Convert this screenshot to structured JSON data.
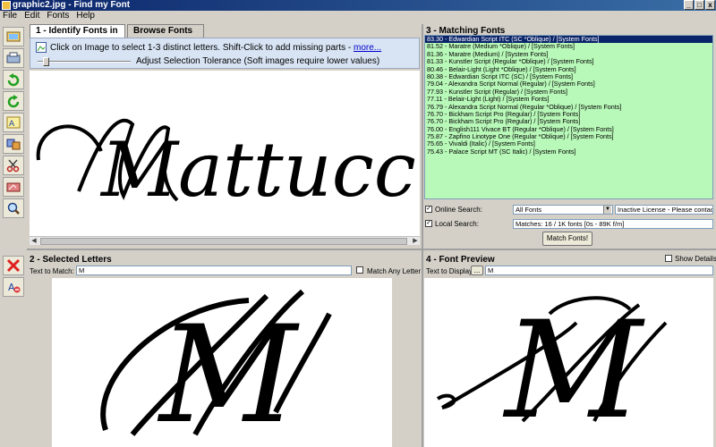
{
  "window": {
    "title": "graphic2.jpg - Find my Font"
  },
  "menu": [
    "File",
    "Edit",
    "Fonts",
    "Help"
  ],
  "panel1": {
    "tabs": [
      "1 - Identify Fonts in Image",
      "Browse Fonts"
    ],
    "info_text": "Click on Image to select 1-3 distinct letters. Shift-Click to add missing parts - ",
    "info_link": "more...",
    "slider_label": "Adjust Selection Tolerance (Soft images require lower values)",
    "slider_value": 0.06,
    "image_text": "Mattucci"
  },
  "panel2": {
    "title": "2 - Selected Letters",
    "text_label": "Text to Match:",
    "text_value": "M",
    "match_any_label": "Match Any Letter",
    "match_any_checked": false,
    "image_text": "M"
  },
  "panel3": {
    "title": "3 - Matching Fonts",
    "results": [
      "83.30 - Edwardian Script ITC (SC *Oblique) / [System Fonts]",
      "81.52 - Maratre (Medium *Oblique) / [System Fonts]",
      "81.36 - Maratre (Medium) / [System Fonts]",
      "81.33 - Kunstler Script (Regular *Oblique) / [System Fonts]",
      "80.46 - Belair-Light (Light *Oblique) / [System Fonts]",
      "80.38 - Edwardian Script ITC (SC) / [System Fonts]",
      "79.04 - Alexandra Script Normal (Regular) / [System Fonts]",
      "77.93 - Kunstler Script (Regular) / [System Fonts]",
      "77.11 - Belair-Light (Light) / [System Fonts]",
      "76.79 - Alexandra Script Normal (Regular *Oblique) / [System Fonts]",
      "76.70 - Bickham Script Pro (Regular) / [System Fonts]",
      "76.70 - Bickham Script Pro (Regular) / [System Fonts]",
      "76.00 - English111 Vivace BT (Regular *Oblique) / [System Fonts]",
      "75.87 - Zapfino Linotype One (Regular *Oblique) / [System Fonts]",
      "75.65 - Vivaldi (Italic) / [System Fonts]",
      "75.43 - Palace Script MT (SC Italic) / [System Fonts]"
    ],
    "online_search_label": "Online Search:",
    "online_search_checked": true,
    "online_select": "All Fonts",
    "license_text": "Inactive License - Please contact sup",
    "local_search_label": "Local Search:",
    "local_search_checked": true,
    "matches_text": "Matches: 16 / 1K fonts [0s - 89K f/m]",
    "match_button": "Match Fonts!"
  },
  "panel4": {
    "title": "4 - Font Preview",
    "show_details_label": "Show Details",
    "show_details_checked": false,
    "text_label": "Text to Display:",
    "ellipsis_button": "...",
    "text_value": "M",
    "image_text": "M"
  },
  "icons": {
    "left_toolbar_top": [
      "open-image-icon",
      "scan-icon",
      "undo-icon",
      "redo-icon",
      "select-letters-icon",
      "merge-icon",
      "cut-icon",
      "erase-icon",
      "zoom-icon"
    ],
    "left_toolbar_bottom": [
      "delete-icon",
      "remove-letter-icon"
    ]
  },
  "colors": {
    "accent_green": "#b8f8b8",
    "selected_row": "#0a246a",
    "info_bg": "#d8e4f4"
  }
}
